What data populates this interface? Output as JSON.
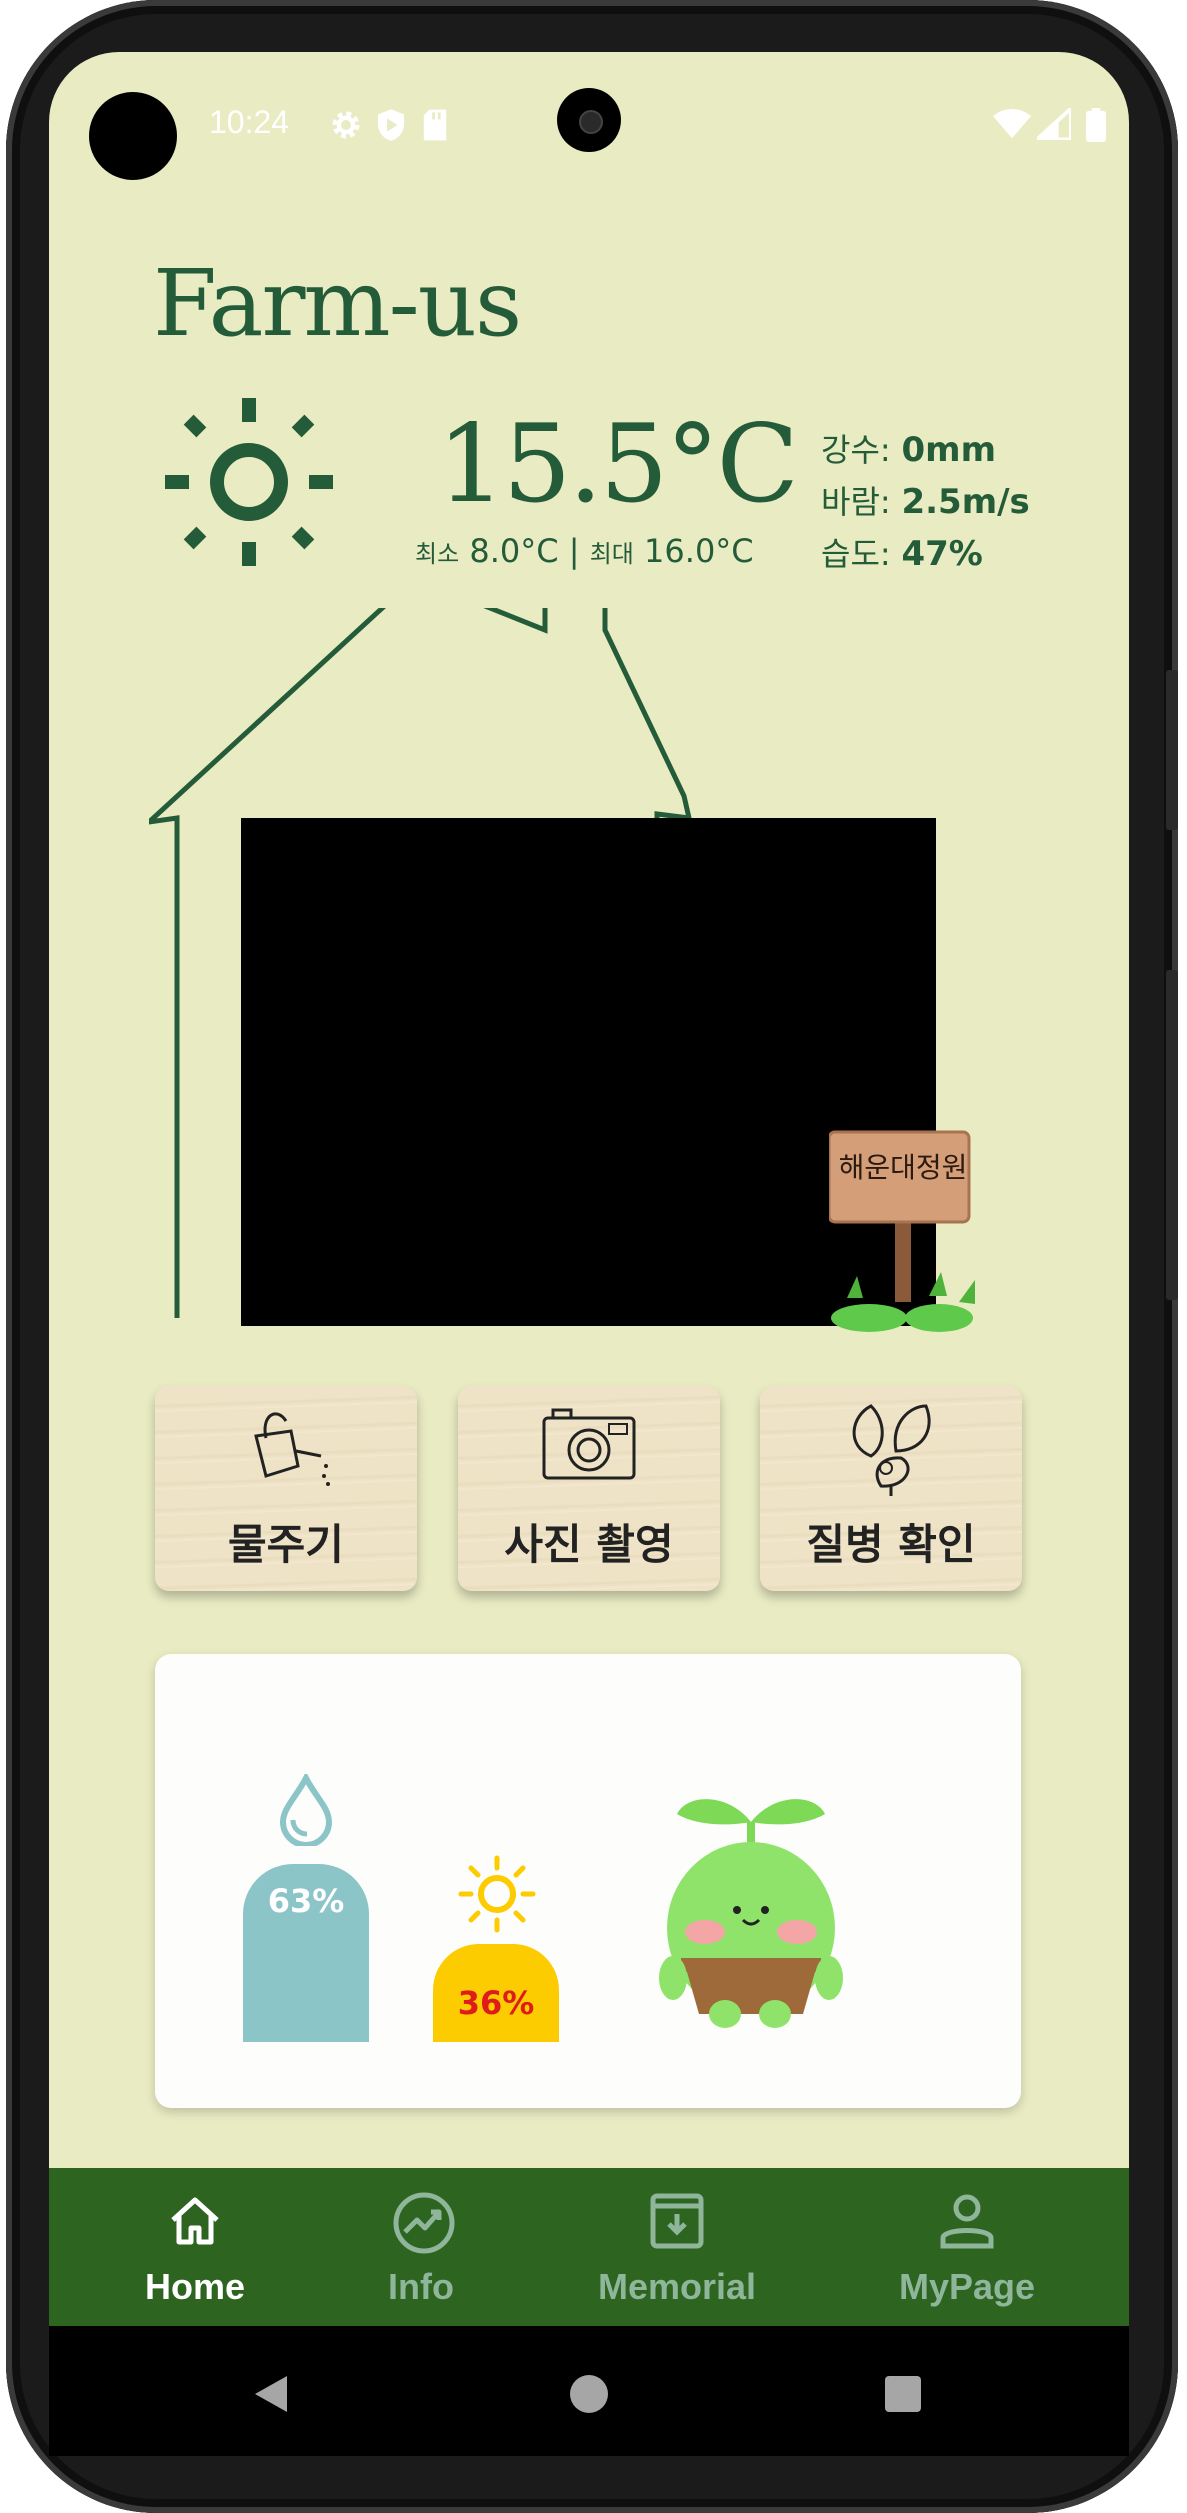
{
  "status_bar": {
    "time": "10:24",
    "icons": [
      "gear-icon",
      "shield-play-icon",
      "sd-card-icon",
      "wifi-icon",
      "signal-icon",
      "battery-icon"
    ]
  },
  "app": {
    "title": "Farm-us"
  },
  "weather": {
    "icon": "sun-icon",
    "temperature": "15.5°C",
    "min_label": "최소",
    "min_value": "8.0°C",
    "divider": "|",
    "max_label": "최대",
    "max_value": "16.0°C",
    "precip_label": "강수:",
    "precip_value": "0mm",
    "wind_label": "바람:",
    "wind_value": "2.5m/s",
    "humidity_label": "습도:",
    "humidity_value": "47%"
  },
  "garden": {
    "sign_text": "해운대정원"
  },
  "actions": [
    {
      "label": "물주기",
      "icon": "watering-can-icon"
    },
    {
      "label": "사진 촬영",
      "icon": "camera-icon"
    },
    {
      "label": "질병 확인",
      "icon": "leaf-bug-icon"
    }
  ],
  "status_card": {
    "water_icon": "water-drop-icon",
    "water_level": "63%",
    "water_fraction": 0.63,
    "sun_icon": "sun-icon",
    "sun_level": "36%",
    "sun_fraction": 0.36,
    "character": "sprout-character"
  },
  "nav": {
    "items": [
      {
        "label": "Home",
        "icon": "home-icon",
        "active": true
      },
      {
        "label": "Info",
        "icon": "chart-circle-icon",
        "active": false
      },
      {
        "label": "Memorial",
        "icon": "archive-box-icon",
        "active": false
      },
      {
        "label": "MyPage",
        "icon": "person-icon",
        "active": false
      }
    ]
  },
  "colors": {
    "background": "#e9ebc3",
    "primary_green": "#245c39",
    "nav_green": "#2c6420",
    "nav_active": "#ffffff",
    "nav_inactive": "#8fb59a",
    "water": "#8bc5c7",
    "sun": "#fccb00",
    "sun_text": "#e01b1b"
  }
}
